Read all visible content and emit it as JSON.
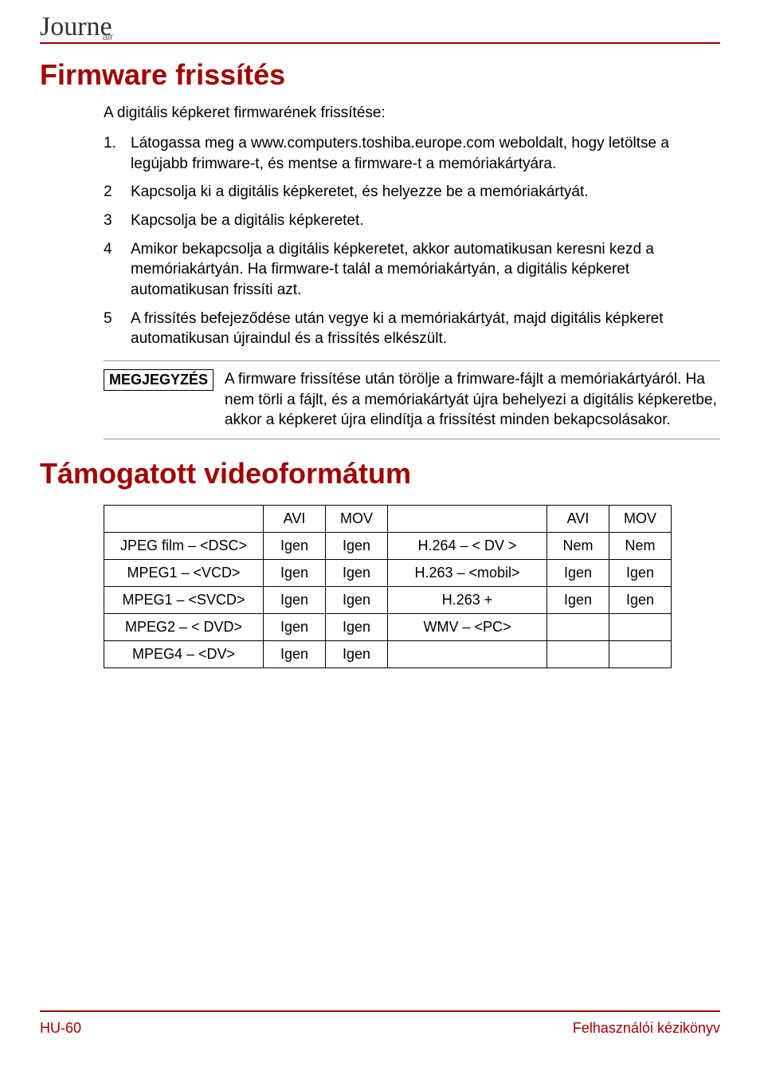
{
  "logo": {
    "main": "Journe",
    "sub": "air"
  },
  "section1": {
    "title": "Firmware frissítés",
    "intro": "A digitális képkeret firmwarének frissítése:",
    "steps": [
      {
        "n": "1.",
        "t": "Látogassa meg a www.computers.toshiba.europe.com weboldalt, hogy letöltse a legújabb frimware-t, és mentse a firmware-t a memóriakártyára."
      },
      {
        "n": "2",
        "t": "Kapcsolja ki a digitális képkeretet, és helyezze be a memóriakártyát."
      },
      {
        "n": "3",
        "t": "Kapcsolja be a digitális képkeretet."
      },
      {
        "n": "4",
        "t": "Amikor bekapcsolja a digitális képkeretet, akkor automatikusan keresni kezd a memóriakártyán. Ha firmware-t talál a memóriakártyán, a digitális képkeret automatikusan frissíti azt."
      },
      {
        "n": "5",
        "t": "A frissítés befejeződése után vegye ki a memóriakártyát, majd digitális képkeret automatikusan újraindul és a frissítés elkészült."
      }
    ],
    "note_label": "MEGJEGYZÉS",
    "note_text": "A firmware frissítése után törölje a frimware-fájlt a memóriakártyáról. Ha nem törli a fájlt, és a memóriakártyát újra behelyezi a digitális képkeretbe, akkor a képkeret újra elindítja a frissítést minden bekapcsolásakor."
  },
  "section2": {
    "title": "Támogatott videoformátum",
    "headers": {
      "c1": "",
      "c2": "AVI",
      "c3": "MOV",
      "c4": "",
      "c5": "AVI",
      "c6": "MOV"
    },
    "rows": [
      {
        "c1": "JPEG film – <DSC>",
        "c2": "Igen",
        "c3": "Igen",
        "c4": "H.264 – < DV >",
        "c5": "Nem",
        "c6": "Nem"
      },
      {
        "c1": "MPEG1 – <VCD>",
        "c2": "Igen",
        "c3": "Igen",
        "c4": "H.263 – <mobil>",
        "c5": "Igen",
        "c6": "Igen"
      },
      {
        "c1": "MPEG1 – <SVCD>",
        "c2": "Igen",
        "c3": "Igen",
        "c4": "H.263 +",
        "c5": "Igen",
        "c6": "Igen"
      },
      {
        "c1": "MPEG2 – < DVD>",
        "c2": "Igen",
        "c3": "Igen",
        "c4": "WMV – <PC>",
        "c5": "",
        "c6": ""
      },
      {
        "c1": "MPEG4 – <DV>",
        "c2": "Igen",
        "c3": "Igen",
        "c4": "",
        "c5": "",
        "c6": ""
      }
    ]
  },
  "footer": {
    "left": "HU-60",
    "right": "Felhasználói kézikönyv"
  }
}
